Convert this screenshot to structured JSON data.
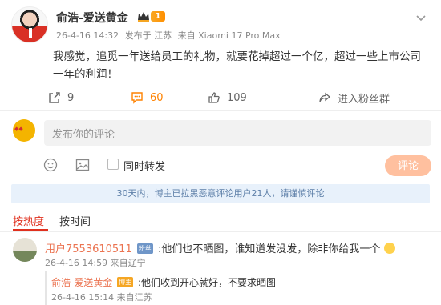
{
  "post": {
    "author": "俞浩-爱送黄金",
    "level": "1",
    "time": "26-4-16 14:32",
    "posted_from": "发布于 江苏",
    "source": "来自 Xiaomi 17 Pro Max",
    "text": "我感觉，追觅一年送给员工的礼物，就要花掉超过一个亿，超过一些上市公司一年的利润！",
    "icons": {
      "repost": "repost-icon",
      "comment": "comment-icon",
      "like": "like-icon",
      "fans": "fans-icon"
    },
    "actions": {
      "reposts": "9",
      "comments": "60",
      "likes": "109",
      "fans_label": "进入粉丝群"
    },
    "accent": "#ff8200"
  },
  "composer": {
    "placeholder": "发布你的评论",
    "also_repost": "同时转发",
    "submit": "评论"
  },
  "notice": "30天内，博主已拉黑恶意评论用户21人，请谨慎评论",
  "sort": {
    "hot": "按热度",
    "time": "按时间"
  },
  "comments": [
    {
      "user": "用户7553610511",
      "badge": "粉丝",
      "text": ":他们也不晒图，谁知道发没发，除非你给我一个",
      "time": "26-4-16 14:59",
      "location": "来自辽宁",
      "reply": {
        "user": "俞浩-爱送黄金",
        "badge": "博主",
        "text": ":他们收到开心就好，不要求晒图",
        "time": "26-4-16 15:14",
        "location": "来自江苏"
      }
    }
  ]
}
